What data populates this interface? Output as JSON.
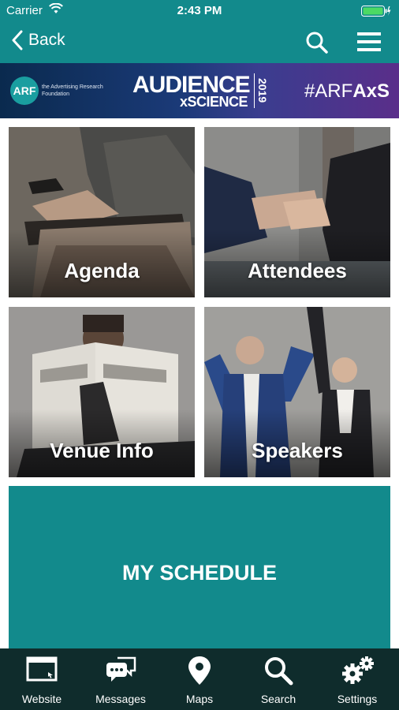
{
  "status": {
    "carrier": "Carrier",
    "time": "2:43 PM"
  },
  "nav": {
    "back_label": "Back"
  },
  "banner": {
    "arf_logo": "ARF",
    "arf_name": "the Advertising Research Foundation",
    "event_line1": "AUDIENCE",
    "event_line2": "xSCIENCE",
    "event_year": "2019",
    "hashtag_prefix": "#ARF",
    "hashtag_bold": "AxS"
  },
  "tiles": {
    "agenda": "Agenda",
    "attendees": "Attendees",
    "venue": "Venue Info",
    "speakers": "Speakers"
  },
  "schedule_label": "MY SCHEDULE",
  "tabs": {
    "website": "Website",
    "messages": "Messages",
    "maps": "Maps",
    "search": "Search",
    "settings": "Settings"
  },
  "colors": {
    "primary": "#128a8c",
    "tab_bar": "#0f2c2c"
  }
}
